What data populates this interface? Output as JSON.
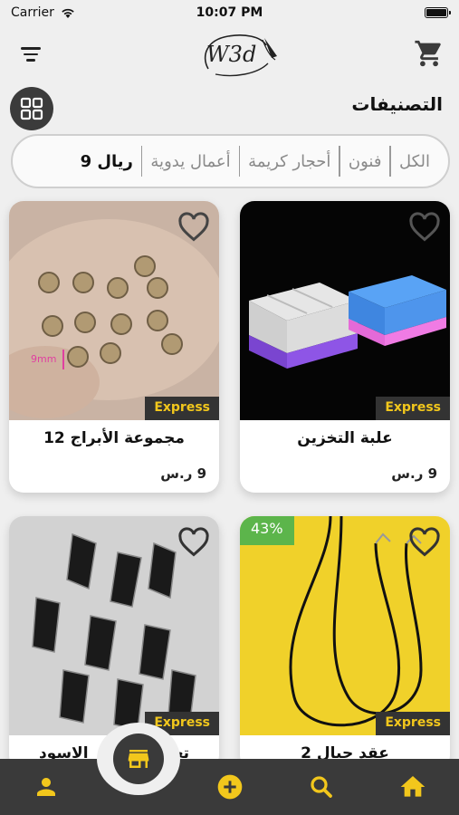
{
  "status_bar": {
    "carrier": "Carrier",
    "time": "10:07 PM"
  },
  "header": {
    "logo_text": "W3d"
  },
  "section": {
    "title": "التصنيفات"
  },
  "categories": [
    {
      "label": "الكل"
    },
    {
      "label": "فنون"
    },
    {
      "label": "أحجار كريمة"
    },
    {
      "label": "أعمال يدوية"
    },
    {
      "label": "9 ريال"
    }
  ],
  "products": [
    {
      "title": "علبة التخزين",
      "price": "9 ر.س",
      "badge": "Express"
    },
    {
      "title": "مجموعة الأبراج 12",
      "price": "9 ر.س",
      "badge": "Express",
      "image_label": "9mm"
    },
    {
      "title": "2 عقد حبال",
      "badge": "Express",
      "discount": "43%"
    },
    {
      "title": "تعليقة الحجر الاسود",
      "badge": "Express"
    }
  ],
  "colors": {
    "accent": "#f2c71c",
    "nav_bg": "#3a3a3a",
    "discount": "#5cb54b",
    "badge_bg": "#333333"
  },
  "nav": {
    "items": [
      "profile-icon",
      "store-icon",
      "add-icon",
      "search-icon",
      "home-icon"
    ]
  }
}
